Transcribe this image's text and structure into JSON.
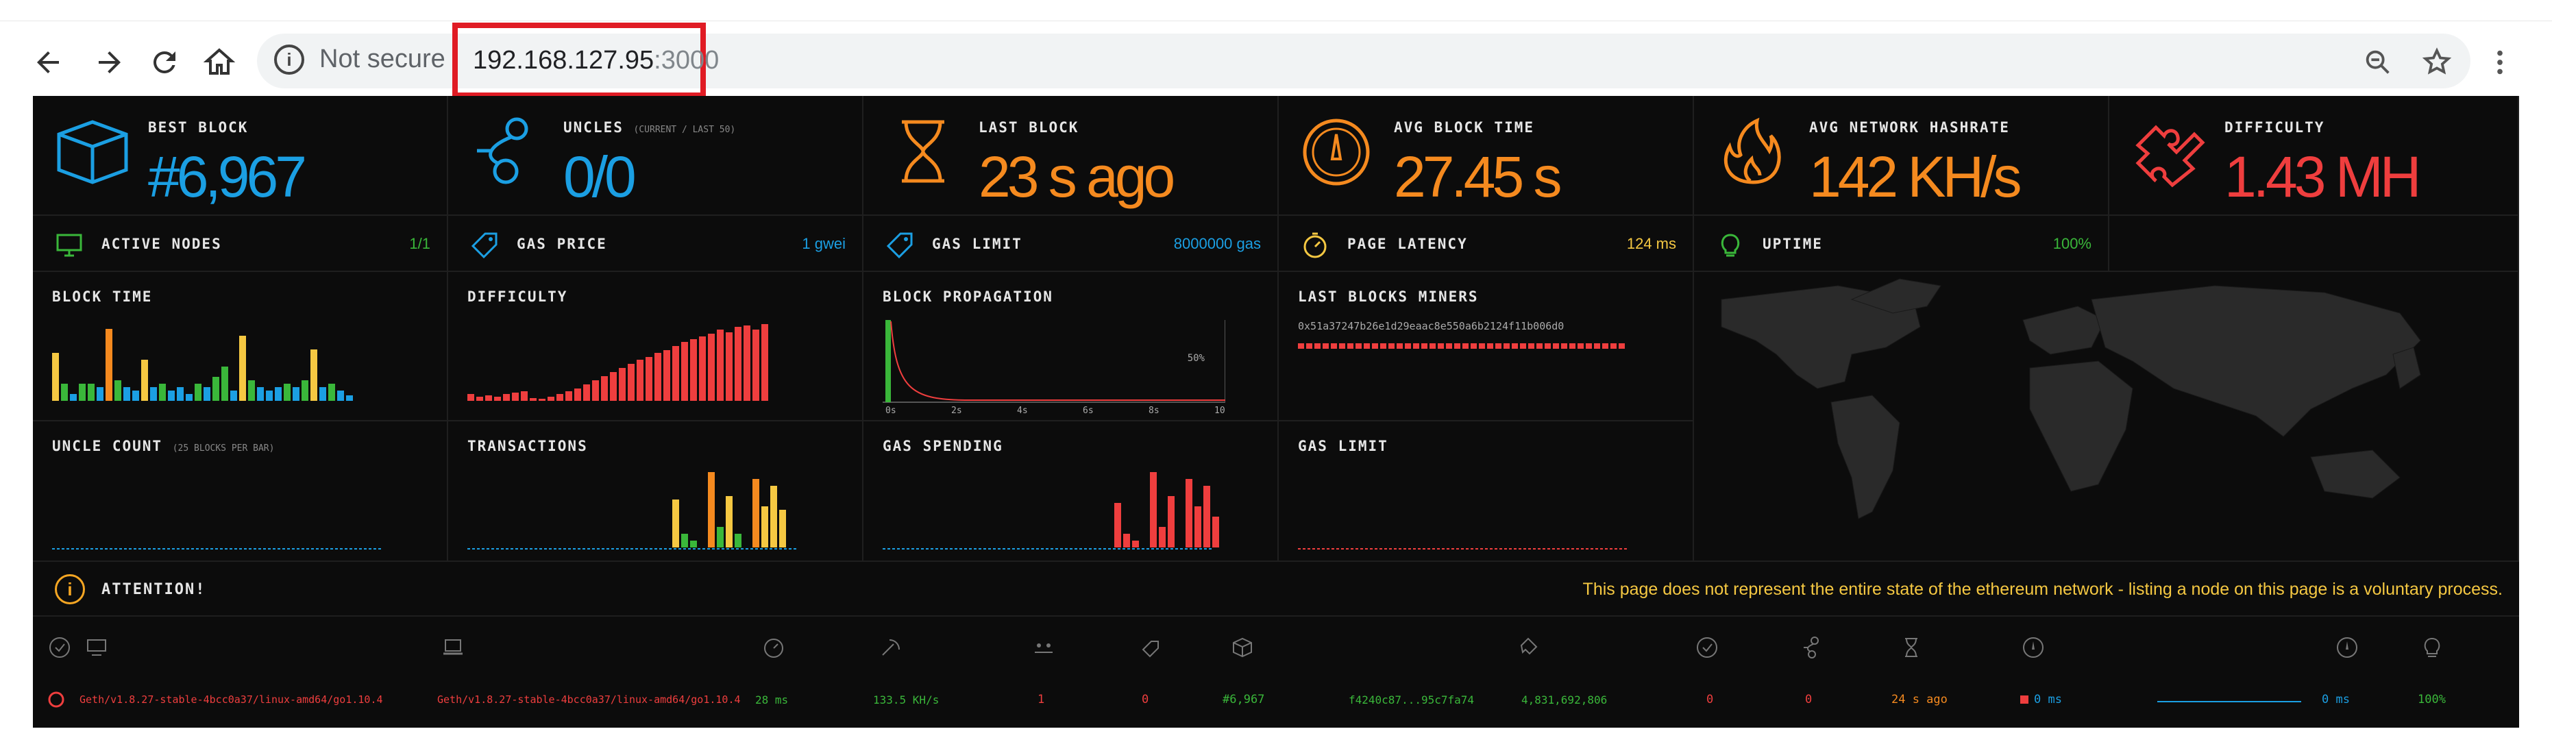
{
  "browser": {
    "not_secure": "Not secure",
    "url_host": "192.168.127.95",
    "url_port": ":3000"
  },
  "stats": [
    {
      "key": "best_block",
      "title": "BEST BLOCK",
      "sub": "",
      "value": "#6,967",
      "color": "#1b9fe3",
      "icon": "cube-icon"
    },
    {
      "key": "uncles",
      "title": "UNCLES",
      "sub": "(CURRENT / LAST 50)",
      "value": "0/0",
      "color": "#1b9fe3",
      "icon": "uncles-icon"
    },
    {
      "key": "last_block",
      "title": "LAST BLOCK",
      "sub": "",
      "value": "23 s ago",
      "color": "#f58a1f",
      "icon": "hourglass-icon"
    },
    {
      "key": "avg_block_time",
      "title": "AVG BLOCK TIME",
      "sub": "",
      "value": "27.45 s",
      "color": "#f58a1f",
      "icon": "gauge-icon"
    },
    {
      "key": "avg_hashrate",
      "title": "AVG NETWORK HASHRATE",
      "sub": "",
      "value": "142 KH/s",
      "color": "#f58a1f",
      "icon": "flame-icon"
    },
    {
      "key": "difficulty",
      "title": "DIFFICULTY",
      "sub": "",
      "value": "1.43 MH",
      "color": "#ef3e3e",
      "icon": "puzzle-icon"
    }
  ],
  "mini_stats": [
    {
      "key": "active_nodes",
      "title": "ACTIVE NODES",
      "value": "1/1",
      "color": "#3ab73a",
      "icon": "monitor-icon"
    },
    {
      "key": "gas_price",
      "title": "GAS PRICE",
      "value": "1 gwei",
      "color": "#1b9fe3",
      "icon": "tag-icon"
    },
    {
      "key": "gas_limit",
      "title": "GAS LIMIT",
      "value": "8000000 gas",
      "color": "#1b9fe3",
      "icon": "tag-icon"
    },
    {
      "key": "page_latency",
      "title": "PAGE LATENCY",
      "value": "124 ms",
      "color": "#f5c842",
      "icon": "timer-icon"
    },
    {
      "key": "uptime",
      "title": "UPTIME",
      "value": "100%",
      "color": "#3ab73a",
      "icon": "bulb-icon"
    }
  ],
  "charts": {
    "block_time": {
      "title": "BLOCK TIME"
    },
    "difficulty": {
      "title": "DIFFICULTY"
    },
    "block_propagation": {
      "title": "BLOCK PROPAGATION",
      "x_ticks": [
        "0s",
        "2s",
        "4s",
        "6s",
        "8s",
        "10s"
      ],
      "y_label": "50%"
    },
    "last_blocks_miners": {
      "title": "LAST BLOCKS MINERS",
      "miner": "0x51a37247b26e1d29eaac8e550a6b2124f11b006d0"
    },
    "uncle_count": {
      "title": "UNCLE COUNT",
      "sub": "(25 BLOCKS PER BAR)"
    },
    "transactions": {
      "title": "TRANSACTIONS"
    },
    "gas_spending": {
      "title": "GAS SPENDING"
    },
    "gas_limit": {
      "title": "GAS LIMIT"
    }
  },
  "attention": {
    "title": "ATTENTION!",
    "text": "This page does not represent the entire state of the ethereum network - listing a node on this page is a voluntary process."
  },
  "node": {
    "name": "Geth/v1.8.27-stable-4bcc0a37/linux-amd64/go1.10.4",
    "client": "Geth/v1.8.27-stable-4bcc0a37/linux-amd64/go1.10.4",
    "latency": "28 ms",
    "hashrate": "133.5 KH/s",
    "peers": "1",
    "pending": "0",
    "block": "#6,967",
    "block_hash": "f4240c87...95c7fa74",
    "total_difficulty": "4,831,692,806",
    "uncles_current": "0",
    "uncles_total": "0",
    "last_block": "24 s ago",
    "propagation": "0 ms",
    "avg_propagation": "0 ms",
    "uptime": "100%"
  }
}
